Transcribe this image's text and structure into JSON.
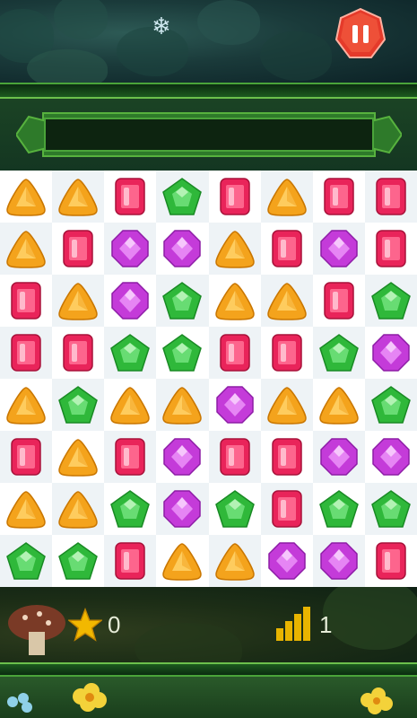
{
  "hud": {
    "score": "0",
    "level": "1",
    "star_icon": "star-icon",
    "level_icon": "level-bars-icon",
    "pause_icon": "pause-icon",
    "pause_color": "#e53a2a"
  },
  "gem_colors": {
    "orange": "#f4a31c",
    "red": "#e9245a",
    "green": "#2fb83a",
    "purple": "#c43bd9"
  },
  "board": {
    "rows": 8,
    "cols": 8,
    "grid": [
      [
        "orange",
        "orange",
        "red",
        "green",
        "red",
        "orange",
        "red",
        "red"
      ],
      [
        "orange",
        "red",
        "purple",
        "purple",
        "orange",
        "red",
        "purple",
        "red"
      ],
      [
        "red",
        "orange",
        "purple",
        "green",
        "orange",
        "orange",
        "red",
        "green"
      ],
      [
        "red",
        "red",
        "green",
        "green",
        "red",
        "red",
        "green",
        "purple"
      ],
      [
        "orange",
        "green",
        "orange",
        "orange",
        "purple",
        "orange",
        "orange",
        "green"
      ],
      [
        "red",
        "orange",
        "red",
        "purple",
        "red",
        "red",
        "purple",
        "purple"
      ],
      [
        "orange",
        "orange",
        "green",
        "purple",
        "green",
        "red",
        "green",
        "green"
      ],
      [
        "green",
        "green",
        "red",
        "orange",
        "orange",
        "purple",
        "purple",
        "red"
      ]
    ]
  }
}
